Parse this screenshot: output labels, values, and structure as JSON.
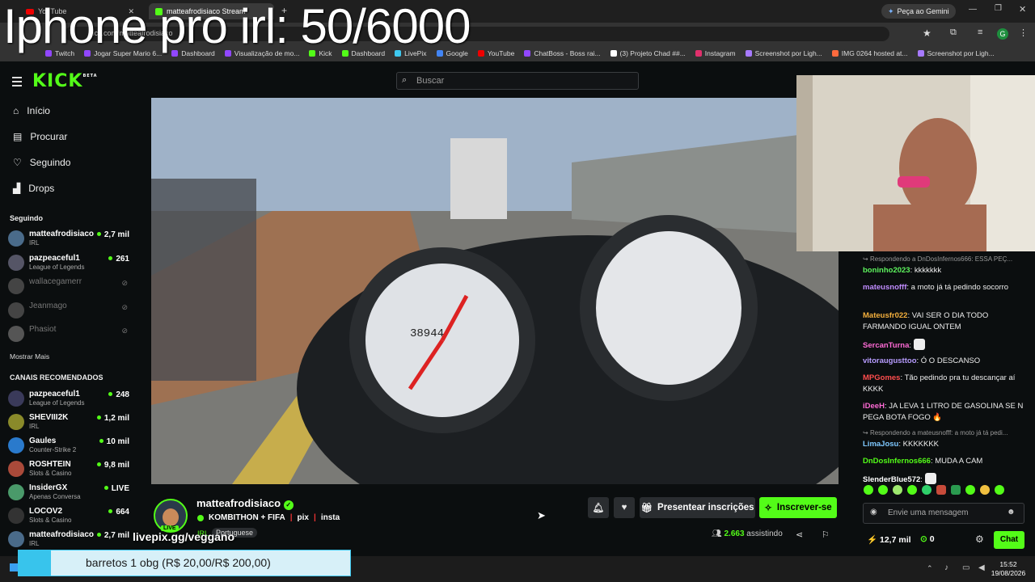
{
  "overlay": {
    "title": "Iphone pro irl: 50/6000",
    "livepix": "livepix.gg/veggano"
  },
  "browser": {
    "tabs": [
      {
        "label": "YouTube"
      },
      {
        "label": "matteafrodisiaco Stream"
      }
    ],
    "gemini_label": "Peça ao Gemini",
    "url": "kick.com/matteafrodisiaco",
    "profile_initial": "G",
    "bookmarks": [
      "Twitch",
      "Jogar Super Mario 6...",
      "Dashboard",
      "Visualização de mo...",
      "Kick",
      "Dashboard",
      "LivePix",
      "Google",
      "YouTube",
      "ChatBoss - Boss rai...",
      "(3) Projeto Chad ##...",
      "Instagram",
      "Screenshot por Ligh...",
      "IMG 0264 hosted at...",
      "Screenshot por Ligh..."
    ]
  },
  "kick": {
    "logo": "KICK",
    "logo_tag": "BETA",
    "search_placeholder": "Buscar",
    "nav": [
      {
        "label": "Início",
        "icon": "home-icon"
      },
      {
        "label": "Procurar",
        "icon": "browse-icon"
      },
      {
        "label": "Seguindo",
        "icon": "heart-icon"
      },
      {
        "label": "Drops",
        "icon": "drops-icon"
      }
    ],
    "following_title": "Seguindo",
    "following": [
      {
        "name": "matteafrodisiaco",
        "category": "IRL",
        "viewers": "2,7 mil",
        "live": true
      },
      {
        "name": "pazpeaceful1",
        "category": "League of Legends",
        "viewers": "261",
        "live": true
      },
      {
        "name": "wallacegamerr",
        "category": "",
        "viewers": "",
        "live": false
      },
      {
        "name": "Jeanmago",
        "category": "",
        "viewers": "",
        "live": false
      },
      {
        "name": "Phasiot",
        "category": "",
        "viewers": "",
        "live": false
      }
    ],
    "show_more": "Mostrar Mais",
    "recommended_title": "CANAIS RECOMENDADOS",
    "recommended": [
      {
        "name": "pazpeaceful1",
        "category": "League of Legends",
        "viewers": "248"
      },
      {
        "name": "SHEVIII2K",
        "category": "IRL",
        "viewers": "1,2 mil"
      },
      {
        "name": "Gaules",
        "category": "Counter-Strike 2",
        "viewers": "10 mil"
      },
      {
        "name": "ROSHTEIN",
        "category": "Slots & Casino",
        "viewers": "9,8 mil"
      },
      {
        "name": "InsiderGX",
        "category": "Apenas Conversa",
        "viewers": "LIVE"
      },
      {
        "name": "LOCOV2",
        "category": "Slots & Casino",
        "viewers": "664"
      },
      {
        "name": "matteafrodisiaco",
        "category": "IRL",
        "viewers": "2,7 mil"
      }
    ]
  },
  "stream": {
    "channel": "matteafrodisiaco",
    "title": "KOMBITHON + FIFA",
    "links": [
      "pix",
      "insta"
    ],
    "category": "IRL",
    "language": "Portuguese",
    "live_badge": "LIVE",
    "gift_label": "Presentear inscrições",
    "subscribe_label": "Inscrever-se",
    "viewers": "2.663",
    "viewers_label": "assistindo",
    "speedometer": "38944"
  },
  "chat": {
    "messages": [
      {
        "reply": "Respondendo a DnDosInfernos666: ESSA PEÇ...",
        "user": "boninho2023",
        "color": "#5ef55e",
        "text": "kkkkkkk"
      },
      {
        "user": "mateusnofff",
        "color": "#c08cff",
        "text": "a moto já tá pedindo socorro"
      },
      {
        "user": "Mateusfr022",
        "color": "#f5b03d",
        "text": "VAI SER O DIA TODO FARMANDO IGUAL ONTEM"
      },
      {
        "user": "SercanTurna",
        "color": "#ff6ad5",
        "text": ""
      },
      {
        "user": "vitoraugusttoo",
        "color": "#b79cff",
        "text": "Ó O DESCANSO"
      },
      {
        "user": "MPGomes",
        "color": "#ff4e4e",
        "text": "Tão pedindo pra tu descançar aí KKKK"
      },
      {
        "user": "iDeeH",
        "color": "#ff6ad5",
        "text": "JA LEVA 1 LITRO DE GASOLINA SE N PEGA BOTA FOGO 🔥"
      },
      {
        "reply": "Respondendo a mateusnofff: a moto já tá pedi...",
        "user": "LimaJosu",
        "color": "#7ec8ff",
        "text": "KKKKKKK"
      },
      {
        "user": "DnDosInfernos666",
        "color": "#53fc18",
        "text": "MUDA A CAM"
      },
      {
        "user": "SlenderBlue572",
        "color": "#ffffff",
        "text": ""
      }
    ],
    "input_placeholder": "Envie uma mensagem",
    "points": "12,7 mil",
    "coins": "0",
    "send_label": "Chat"
  },
  "donation": {
    "text": "barretos 1 obg (R$ 20,00/R$ 200,00)",
    "progress": 0.1
  },
  "taskbar": {
    "time": "15:52",
    "date": "19/08/2026"
  }
}
